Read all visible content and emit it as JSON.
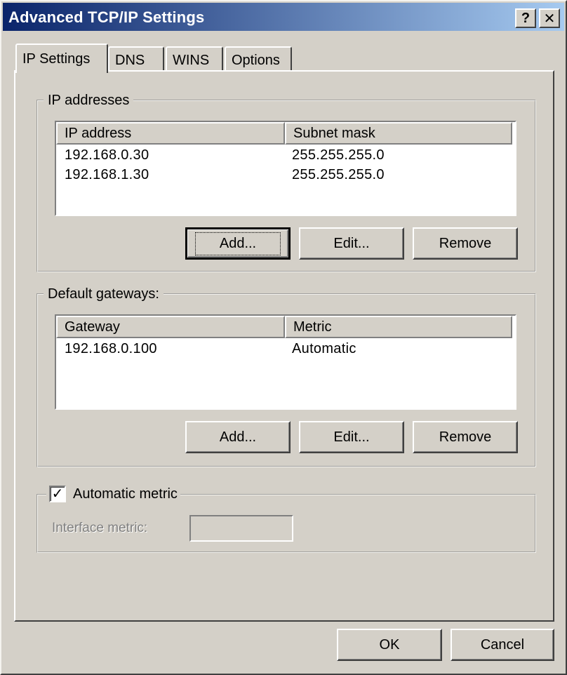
{
  "window": {
    "title": "Advanced TCP/IP Settings",
    "help_label": "?",
    "close_label": "✕"
  },
  "tabs": [
    {
      "label": "IP Settings",
      "active": true
    },
    {
      "label": "DNS",
      "active": false
    },
    {
      "label": "WINS",
      "active": false
    },
    {
      "label": "Options",
      "active": false
    }
  ],
  "ip_addresses": {
    "label": "IP addresses",
    "columns": [
      "IP address",
      "Subnet mask"
    ],
    "rows": [
      [
        "192.168.0.30",
        "255.255.255.0"
      ],
      [
        "192.168.1.30",
        "255.255.255.0"
      ]
    ],
    "add_label": "Add...",
    "edit_label": "Edit...",
    "remove_label": "Remove"
  },
  "default_gateways": {
    "label": "Default gateways:",
    "columns": [
      "Gateway",
      "Metric"
    ],
    "rows": [
      [
        "192.168.0.100",
        "Automatic"
      ]
    ],
    "add_label": "Add...",
    "edit_label": "Edit...",
    "remove_label": "Remove"
  },
  "metric": {
    "checkbox_label": "Automatic metric",
    "checked": true,
    "check_glyph": "✓",
    "interface_label": "Interface metric:",
    "interface_value": ""
  },
  "footer": {
    "ok_label": "OK",
    "cancel_label": "Cancel"
  }
}
